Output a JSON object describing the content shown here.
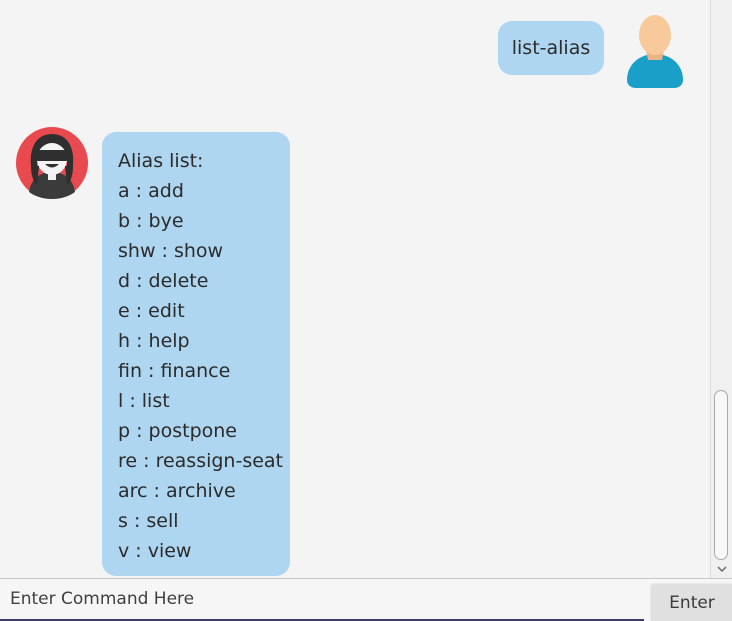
{
  "chat": {
    "user_message": "list-alias",
    "bot_lines": [
      "Alias list:",
      "a : add",
      "b : bye",
      "shw : show",
      "d : delete",
      "e : edit",
      "h : help",
      "fin : finance",
      "l : list",
      "p : postpone",
      "re : reassign-seat",
      "arc : archive",
      "s : sell",
      "v : view"
    ]
  },
  "input": {
    "placeholder": "Enter Command Here",
    "value": ""
  },
  "enter_button": {
    "label": "Enter"
  },
  "colors": {
    "bubble": "#afd6f0",
    "background": "#f4f4f4",
    "user_avatar_body": "#1aa0c8",
    "user_avatar_head": "#f8c99a",
    "bot_avatar_bg": "#e84a4f"
  },
  "icons": {
    "user_avatar": "user-avatar-icon",
    "bot_avatar": "bot-avatar-icon",
    "scroll_down": "chevron-down-icon"
  }
}
